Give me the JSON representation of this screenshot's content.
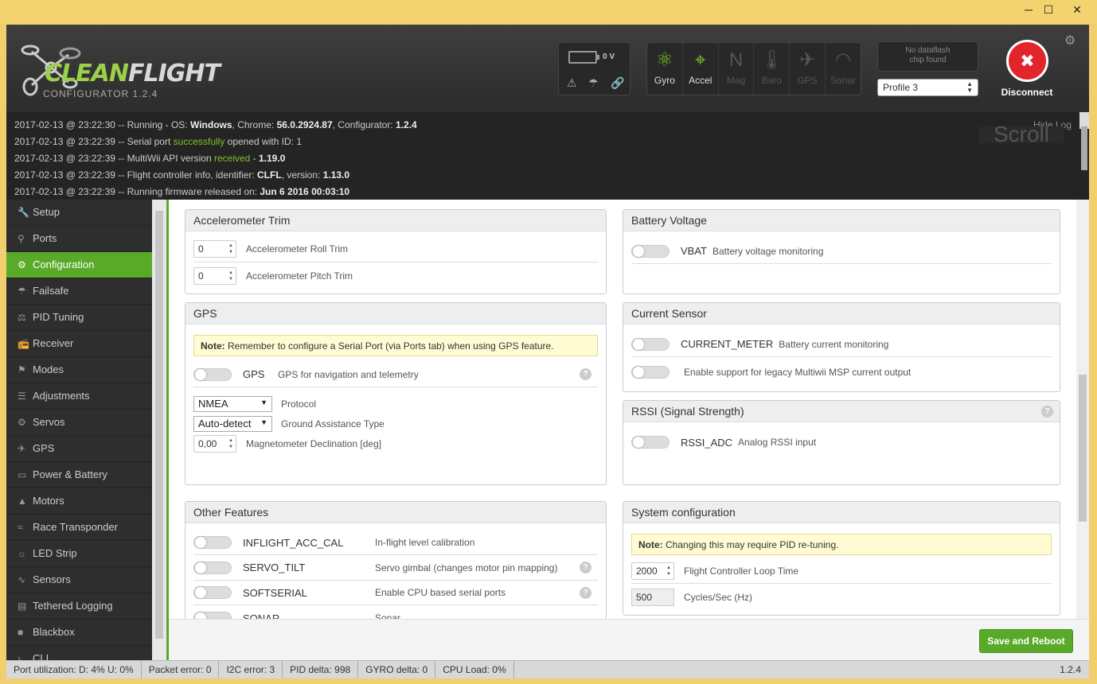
{
  "window": {
    "min": "─",
    "max": "☐",
    "close": "✕"
  },
  "header": {
    "logo_part1": "CLEAN",
    "logo_part2": "FLIGHT",
    "logo_version": "CONFIGURATOR  1.2.4",
    "battery_voltage": "0 V",
    "sensors": [
      {
        "label": "Gyro",
        "icon": "gyro-icon",
        "glyph": "⚛",
        "active": true
      },
      {
        "label": "Accel",
        "icon": "accel-icon",
        "glyph": "⌖",
        "active": true
      },
      {
        "label": "Mag",
        "icon": "mag-icon",
        "glyph": "N",
        "active": false
      },
      {
        "label": "Baro",
        "icon": "baro-icon",
        "glyph": "🌡",
        "active": false
      },
      {
        "label": "GPS",
        "icon": "gps-icon",
        "glyph": "✈",
        "active": false
      },
      {
        "label": "Sonar",
        "icon": "sonar-icon",
        "glyph": "◠",
        "active": false
      }
    ],
    "dataflash": "No dataflash\nchip found",
    "profile": "Profile 3",
    "disconnect": "Disconnect"
  },
  "log": {
    "hide_label": "Hide Log",
    "scroll_label": "Scroll",
    "lines": [
      {
        "pre": "2017-02-13 @ 23:22:30 -- Running - OS: ",
        "b1": "Windows",
        "mid": ", Chrome: ",
        "b2": "56.0.2924.87",
        "mid2": ", Configurator: ",
        "b3": "1.2.4"
      },
      {
        "pre": "2017-02-13 @ 23:22:39 -- Serial port ",
        "ok": "successfully",
        "post": " opened with ID: 1"
      },
      {
        "pre": "2017-02-13 @ 23:22:39 -- MultiWii API version ",
        "ok": "received",
        "post": " - ",
        "b1": "1.19.0"
      },
      {
        "pre": "2017-02-13 @ 23:22:39 -- Flight controller info, identifier: ",
        "b1": "CLFL",
        "mid": ", version: ",
        "b2": "1.13.0"
      },
      {
        "pre": "2017-02-13 @ 23:22:39 -- Running firmware released on: ",
        "b1": "Jun 6 2016 00:03:10"
      }
    ]
  },
  "sidebar": [
    {
      "label": "Setup",
      "icon": "wrench-icon",
      "glyph": "🔧"
    },
    {
      "label": "Ports",
      "icon": "plug-icon",
      "glyph": "⚲"
    },
    {
      "label": "Configuration",
      "icon": "gear-icon",
      "glyph": "⚙",
      "active": true
    },
    {
      "label": "Failsafe",
      "icon": "parachute-icon",
      "glyph": "☂"
    },
    {
      "label": "PID Tuning",
      "icon": "pid-icon",
      "glyph": "⚖"
    },
    {
      "label": "Receiver",
      "icon": "receiver-icon",
      "glyph": "📻"
    },
    {
      "label": "Modes",
      "icon": "modes-icon",
      "glyph": "⚑"
    },
    {
      "label": "Adjustments",
      "icon": "sliders-icon",
      "glyph": "☰"
    },
    {
      "label": "Servos",
      "icon": "servo-icon",
      "glyph": "⚙"
    },
    {
      "label": "GPS",
      "icon": "satellite-icon",
      "glyph": "✈"
    },
    {
      "label": "Power & Battery",
      "icon": "battery-icon",
      "glyph": "▭"
    },
    {
      "label": "Motors",
      "icon": "motor-icon",
      "glyph": "▲"
    },
    {
      "label": "Race Transponder",
      "icon": "transponder-icon",
      "glyph": "≈"
    },
    {
      "label": "LED Strip",
      "icon": "led-icon",
      "glyph": "☼"
    },
    {
      "label": "Sensors",
      "icon": "pulse-icon",
      "glyph": "∿"
    },
    {
      "label": "Tethered Logging",
      "icon": "log-icon",
      "glyph": "▤"
    },
    {
      "label": "Blackbox",
      "icon": "blackbox-icon",
      "glyph": "■"
    },
    {
      "label": "CLI",
      "icon": "cli-icon",
      "glyph": "›"
    }
  ],
  "acc_trim": {
    "title": "Accelerometer Trim",
    "roll_value": "0",
    "roll_label": "Accelerometer Roll Trim",
    "pitch_value": "0",
    "pitch_label": "Accelerometer Pitch Trim"
  },
  "gps": {
    "title": "GPS",
    "note_bold": "Note:",
    "note_text": " Remember to configure a Serial Port (via Ports tab) when using GPS feature.",
    "feature": "GPS",
    "feature_desc": "GPS for navigation and telemetry",
    "protocol_value": "NMEA",
    "protocol_label": "Protocol",
    "ground_value": "Auto-detect",
    "ground_label": "Ground Assistance Type",
    "mag_value": "0,00",
    "mag_label": "Magnetometer Declination [deg]"
  },
  "other": {
    "title": "Other Features",
    "items": [
      {
        "name": "INFLIGHT_ACC_CAL",
        "desc": "In-flight level calibration"
      },
      {
        "name": "SERVO_TILT",
        "desc": "Servo gimbal (changes motor pin mapping)"
      },
      {
        "name": "SOFTSERIAL",
        "desc": "Enable CPU based serial ports"
      },
      {
        "name": "SONAR",
        "desc": "Sonar"
      }
    ]
  },
  "battery": {
    "title": "Battery Voltage",
    "feature": "VBAT",
    "desc": "Battery voltage monitoring"
  },
  "current": {
    "title": "Current Sensor",
    "feature": "CURRENT_METER",
    "desc": "Battery current monitoring",
    "legacy": "Enable support for legacy Multiwii MSP current output"
  },
  "rssi": {
    "title": "RSSI (Signal Strength)",
    "feature": "RSSI_ADC",
    "desc": "Analog RSSI input"
  },
  "sysconf": {
    "title": "System configuration",
    "note_bold": "Note:",
    "note_text": " Changing this may require PID re-tuning.",
    "loop_value": "2000",
    "loop_label": "Flight Controller Loop Time",
    "cycles_value": "500",
    "cycles_label": "Cycles/Sec (Hz)"
  },
  "help_glyph": "?",
  "save_button": "Save and Reboot",
  "status": {
    "port": "Port utilization: D: 4% U: 0%",
    "packet": "Packet error: 0",
    "i2c": "I2C error: 3",
    "pid": "PID delta: 998",
    "gyro": "GYRO delta: 0",
    "cpu": "CPU Load: 0%",
    "version": "1.2.4"
  },
  "colors": {
    "accent": "#59aa29",
    "header": "#333333",
    "disconnect": "#e2242b"
  }
}
